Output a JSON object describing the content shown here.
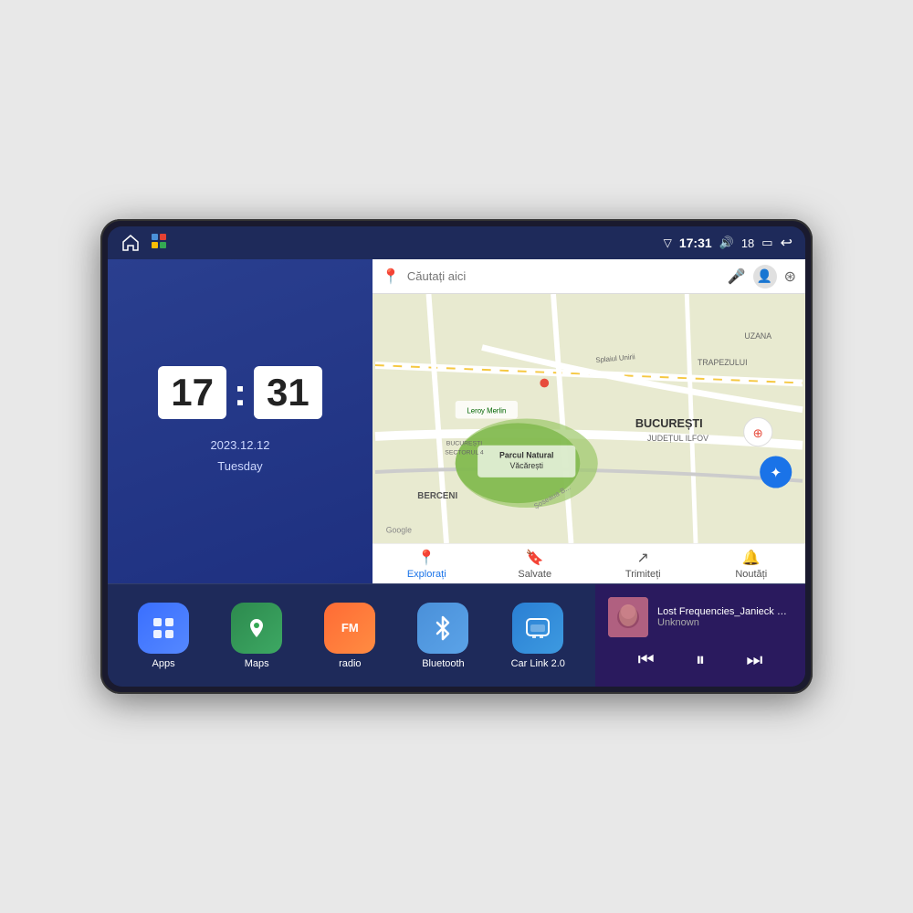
{
  "device": {
    "status_bar": {
      "time": "17:31",
      "signal_icon": "▽",
      "volume_icon": "🔊",
      "battery_level": "18",
      "battery_icon": "🔋",
      "back_icon": "↩"
    },
    "clock": {
      "hour": "17",
      "minute": "31",
      "date": "2023.12.12",
      "day": "Tuesday"
    },
    "map": {
      "search_placeholder": "Căutați aici",
      "tabs": [
        {
          "label": "Explorați",
          "icon": "📍",
          "active": true
        },
        {
          "label": "Salvate",
          "icon": "🔖",
          "active": false
        },
        {
          "label": "Trimiteți",
          "icon": "↗",
          "active": false
        },
        {
          "label": "Noutăți",
          "icon": "🔔",
          "active": false
        }
      ]
    },
    "apps": [
      {
        "label": "Apps",
        "icon": "⊞",
        "color_class": "apps-bg"
      },
      {
        "label": "Maps",
        "icon": "📍",
        "color_class": "maps-bg"
      },
      {
        "label": "radio",
        "icon": "📻",
        "color_class": "radio-bg"
      },
      {
        "label": "Bluetooth",
        "icon": "⚡",
        "color_class": "bluetooth-bg"
      },
      {
        "label": "Car Link 2.0",
        "icon": "🚗",
        "color_class": "carlink-bg"
      }
    ],
    "music": {
      "title": "Lost Frequencies_Janieck Devy-...",
      "artist": "Unknown",
      "controls": {
        "prev": "⏮",
        "play_pause": "⏸",
        "next": "⏭"
      }
    }
  }
}
